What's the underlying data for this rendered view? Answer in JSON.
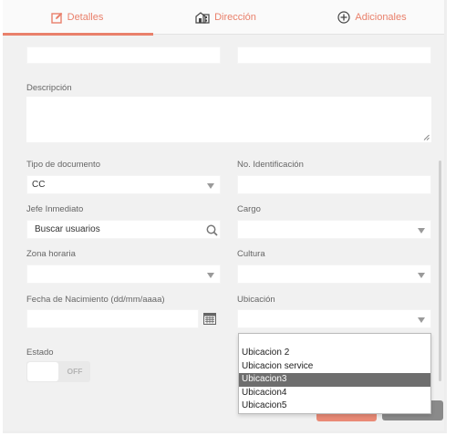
{
  "tabs": [
    {
      "label": "Detalles",
      "icon": "edit-icon"
    },
    {
      "label": "Dirección",
      "icon": "building-icon"
    },
    {
      "label": "Adicionales",
      "icon": "plus-circle-icon"
    }
  ],
  "colors": {
    "accent": "#e9806b",
    "panel": "#f1f1f1",
    "selected": "#6e6e6e"
  },
  "form": {
    "descripcion_label": "Descripción",
    "tipo_documento_label": "Tipo de documento",
    "tipo_documento_value": "CC",
    "no_identificacion_label": "No. Identificación",
    "jefe_inmediato_label": "Jefe Inmediato",
    "jefe_inmediato_placeholder": "Buscar usuarios",
    "cargo_label": "Cargo",
    "zona_horaria_label": "Zona horaria",
    "cultura_label": "Cultura",
    "fecha_nacimiento_label": "Fecha de Nacimiento (dd/mm/aaaa)",
    "ubicacion_label": "Ubicación",
    "estado_label": "Estado",
    "estado_toggle": "OFF"
  },
  "ubicacion_options": [
    "Ubicacion 2",
    "Ubicacion service",
    "Ubicacion3",
    "Ubicacion4",
    "Ubicacion5"
  ],
  "ubicacion_selected": "Ubicacion3"
}
